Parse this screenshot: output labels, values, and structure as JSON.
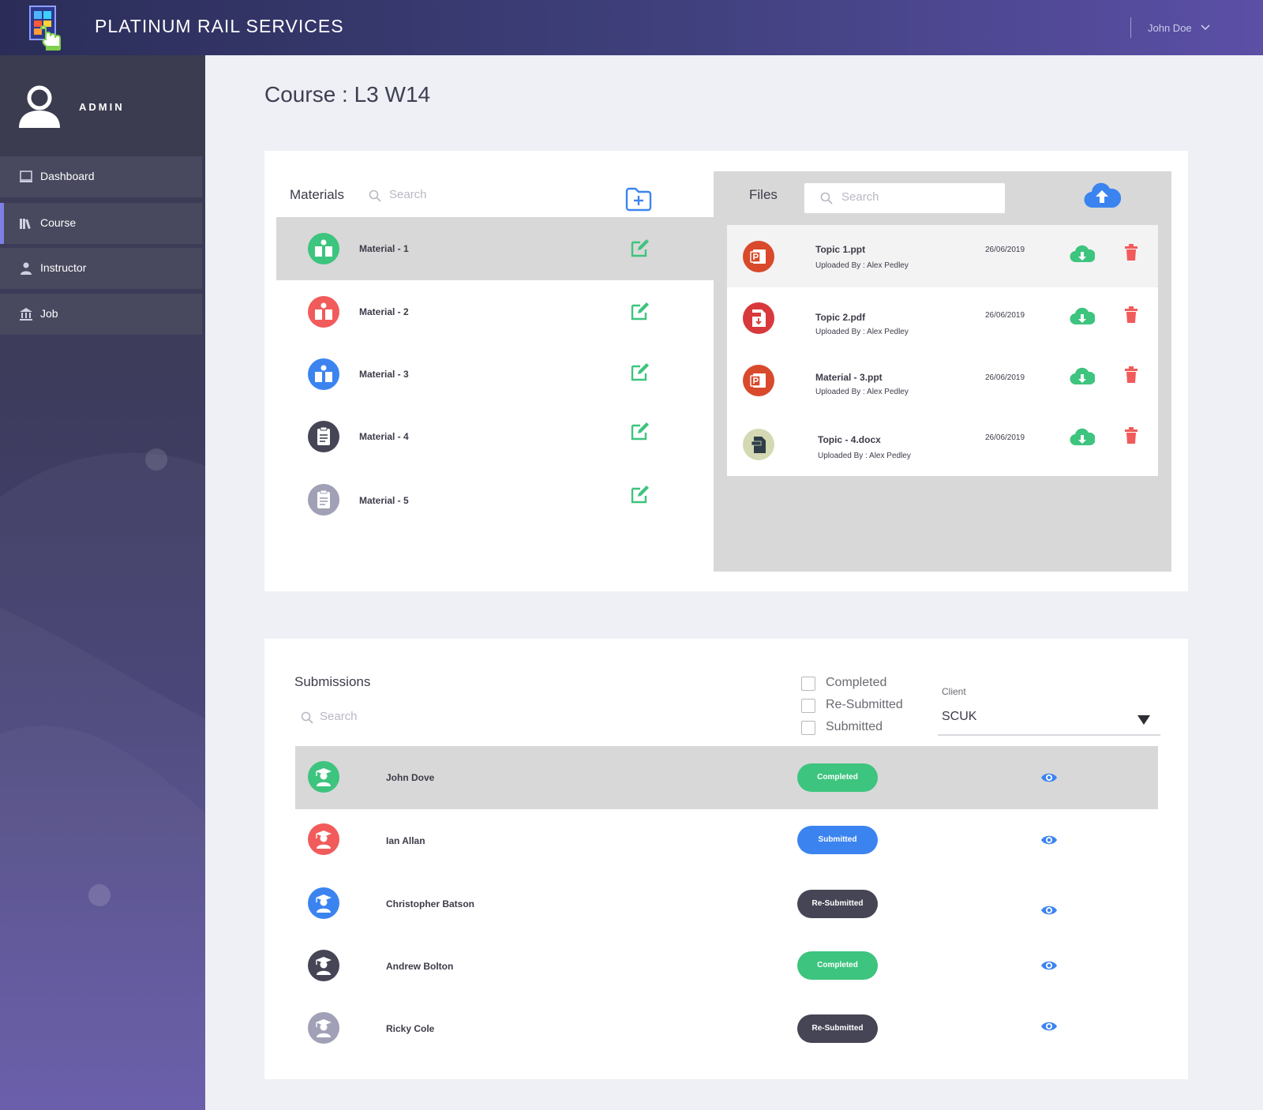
{
  "app": {
    "title": "PLATINUM RAIL SERVICES",
    "user_name": "John Doe"
  },
  "colors": {
    "header_start": "#2b2d58",
    "header_end": "#5b4fa6",
    "green": "#3dc47e",
    "red": "#f15b5b",
    "blue": "#3b84f0",
    "dark": "#454556",
    "grey": "#a0a0b6"
  },
  "sidebar": {
    "role": "ADMIN",
    "items": [
      {
        "label": "Dashboard",
        "icon": "monitor-icon",
        "active": false
      },
      {
        "label": "Course",
        "icon": "books-icon",
        "active": true
      },
      {
        "label": "Instructor",
        "icon": "person-icon",
        "active": false
      },
      {
        "label": "Job",
        "icon": "bank-icon",
        "active": false
      }
    ]
  },
  "page": {
    "title": "Course : L3 W14"
  },
  "materials": {
    "title": "Materials",
    "search_placeholder": "Search",
    "items": [
      {
        "label": "Material - 1",
        "color": "#3dc47e",
        "icon": "book-icon",
        "selected": true
      },
      {
        "label": "Material - 2",
        "color": "#f15b5b",
        "icon": "book-icon",
        "selected": false
      },
      {
        "label": "Material - 3",
        "color": "#3b84f0",
        "icon": "book-icon",
        "selected": false
      },
      {
        "label": "Material - 4",
        "color": "#454556",
        "icon": "clipboard-icon",
        "selected": false
      },
      {
        "label": "Material - 5",
        "color": "#a0a0b6",
        "icon": "clipboard-icon",
        "selected": false
      }
    ]
  },
  "files": {
    "title": "Files",
    "search_placeholder": "Search",
    "items": [
      {
        "name": "Topic 1.ppt",
        "uploaded_by": "Uploaded By : Alex Pedley",
        "date": "26/06/2019",
        "type": "ppt"
      },
      {
        "name": "Topic 2.pdf",
        "uploaded_by": "Uploaded By : Alex Pedley",
        "date": "26/06/2019",
        "type": "pdf"
      },
      {
        "name": "Material - 3.ppt",
        "uploaded_by": "Uploaded By : Alex Pedley",
        "date": "26/06/2019",
        "type": "ppt"
      },
      {
        "name": "Topic - 4.docx",
        "uploaded_by": "Uploaded By : Alex Pedley",
        "date": "26/06/2019",
        "type": "docx"
      }
    ]
  },
  "submissions": {
    "title": "Submissions",
    "search_placeholder": "Search",
    "filters": [
      {
        "label": "Completed",
        "checked": false
      },
      {
        "label": "Re-Submitted",
        "checked": false
      },
      {
        "label": "Submitted",
        "checked": false
      }
    ],
    "client_label": "Client",
    "client_value": "SCUK",
    "rows": [
      {
        "name": "John Dove",
        "status": "Completed",
        "status_color": "#3dc47e",
        "avatar_color": "#3dc47e",
        "selected": true
      },
      {
        "name": "Ian Allan",
        "status": "Submitted",
        "status_color": "#3b84f0",
        "avatar_color": "#f15b5b",
        "selected": false
      },
      {
        "name": "Christopher Batson",
        "status": "Re-Submitted",
        "status_color": "#454556",
        "avatar_color": "#3b84f0",
        "selected": false
      },
      {
        "name": "Andrew Bolton",
        "status": "Completed",
        "status_color": "#3dc47e",
        "avatar_color": "#454556",
        "selected": false
      },
      {
        "name": "Ricky Cole",
        "status": "Re-Submitted",
        "status_color": "#454556",
        "avatar_color": "#a0a0b6",
        "selected": false
      }
    ]
  }
}
